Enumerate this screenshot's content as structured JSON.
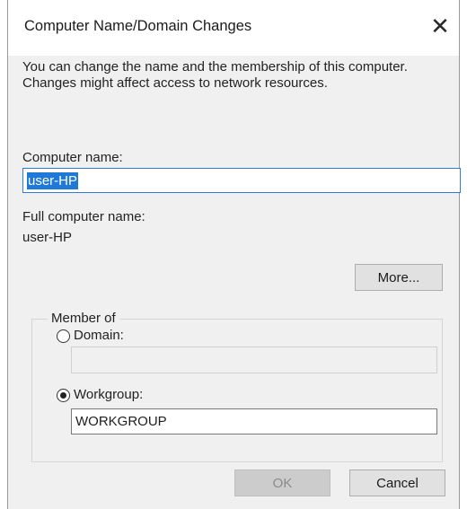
{
  "window": {
    "title": "Computer Name/Domain Changes",
    "close_glyph": "✕"
  },
  "description": "You can change the name and the membership of this computer. Changes might affect access to network resources.",
  "computer_name": {
    "label": "Computer name:",
    "value": "user-HP"
  },
  "full_computer_name": {
    "label": "Full computer name:",
    "value": "user-HP"
  },
  "buttons": {
    "more": "More...",
    "ok": "OK",
    "cancel": "Cancel"
  },
  "member_of": {
    "title": "Member of",
    "domain": {
      "label": "Domain:",
      "value": "",
      "selected": false
    },
    "workgroup": {
      "label": "Workgroup:",
      "value": "WORKGROUP",
      "selected": true
    }
  },
  "colors": {
    "selection": "#1e7ad6",
    "focus_border": "#2f7bd6",
    "dialog_background": "#f0f0f0"
  }
}
